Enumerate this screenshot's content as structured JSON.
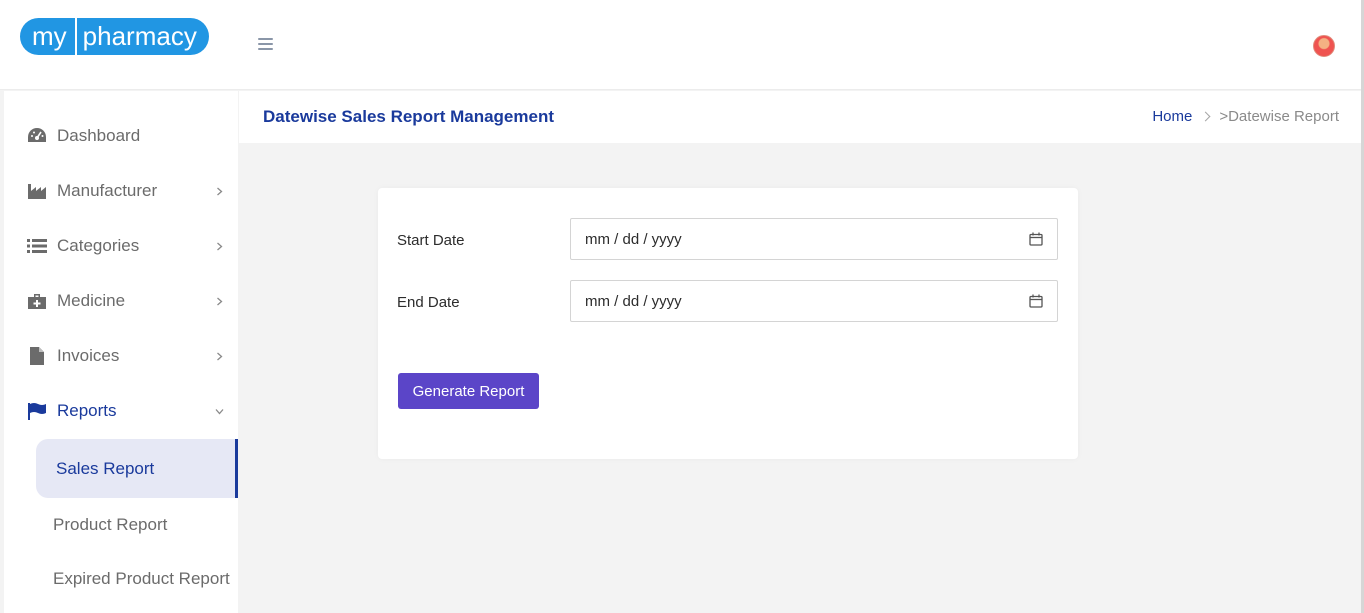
{
  "brand": {
    "logo_left": "my",
    "logo_right": "pharmacy"
  },
  "header": {
    "page_title": "Datewise Sales Report Management",
    "breadcrumb": {
      "home": "Home",
      "current": ">Datewise Report"
    }
  },
  "sidebar": {
    "items": [
      {
        "label": "Dashboard",
        "icon": "dashboard-icon"
      },
      {
        "label": "Manufacturer",
        "icon": "factory-icon"
      },
      {
        "label": "Categories",
        "icon": "list-icon"
      },
      {
        "label": "Medicine",
        "icon": "medkit-icon"
      },
      {
        "label": "Invoices",
        "icon": "file-icon"
      },
      {
        "label": "Reports",
        "icon": "flag-icon"
      }
    ],
    "reports_sub": [
      {
        "label": "Sales Report"
      },
      {
        "label": "Product Report"
      },
      {
        "label": "Expired Product Report"
      }
    ]
  },
  "form": {
    "start_label": "Start Date",
    "start_value": "mm / dd / yyyy",
    "end_label": "End Date",
    "end_value": "mm / dd / yyyy",
    "submit_label": "Generate Report"
  },
  "colors": {
    "brand": "#2196e3",
    "accent": "#1a3a9c",
    "button": "#5b45c8"
  }
}
